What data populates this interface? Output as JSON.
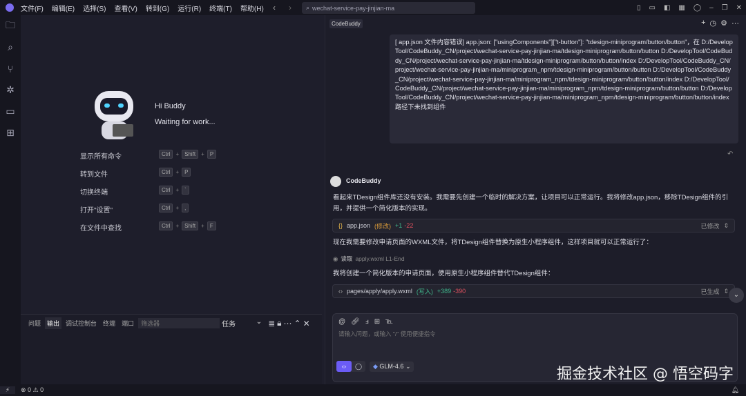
{
  "menu": [
    "文件(F)",
    "编辑(E)",
    "选择(S)",
    "查看(V)",
    "转到(G)",
    "运行(R)",
    "终端(T)",
    "帮助(H)"
  ],
  "search": "wechat-service-pay-jinjian-ma",
  "welcome": {
    "greeting": "Hi Buddy",
    "status": "Waiting for work..."
  },
  "commands": [
    {
      "label": "显示所有命令",
      "keys": [
        "Ctrl",
        "Shift",
        "P"
      ]
    },
    {
      "label": "转到文件",
      "keys": [
        "Ctrl",
        "P"
      ]
    },
    {
      "label": "切换终端",
      "keys": [
        "Ctrl",
        "`"
      ]
    },
    {
      "label": "打开\"设置\"",
      "keys": [
        "Ctrl",
        ","
      ]
    },
    {
      "label": "在文件中查找",
      "keys": [
        "Ctrl",
        "Shift",
        "F"
      ]
    }
  ],
  "panel": {
    "tabs": [
      "问题",
      "输出",
      "调试控制台",
      "终端",
      "端口"
    ],
    "filter_placeholder": "筛选器",
    "task_select": "任务"
  },
  "chat": {
    "tab": "CodeBuddy",
    "user_message": "[ app.json 文件内容错误] app.json: [\"usingComponents\"][\"t-button\"]: \"tdesign-miniprogram/button/button\"，在 D:/DevelopTool/CodeBuddy_CN/project/wechat-service-pay-jinjian-ma/tdesign-miniprogram/button/button D:/DevelopTool/CodeBuddy_CN/project/wechat-service-pay-jinjian-ma/tdesign-miniprogram/button/button/index D:/DevelopTool/CodeBuddy_CN/project/wechat-service-pay-jinjian-ma/miniprogram_npm/tdesign-miniprogram/button/button D:/DevelopTool/CodeBuddy_CN/project/wechat-service-pay-jinjian-ma/miniprogram_npm/tdesign-miniprogram/button/button/index D:/DevelopTool/CodeBuddy_CN/project/wechat-service-pay-jinjian-ma/miniprogram_npm/tdesign-miniprogram/button/button D:/DevelopTool/CodeBuddy_CN/project/wechat-service-pay-jinjian-ma/miniprogram_npm/tdesign-miniprogram/button/button/index 路径下未找到组件",
    "assistant_name": "CodeBuddy",
    "p1": "看起来TDesign组件库还没有安装。我需要先创建一个临时的解决方案，让项目可以正常运行。我将修改app.json，移除TDesign组件的引用，并提供一个简化版本的实现。",
    "file1": {
      "name": "app.json",
      "tag": "(修改)",
      "add": "+1",
      "del": "-22",
      "state": "已修改"
    },
    "p2": "现在我需要修改申请页面的WXML文件，将TDesign组件替换为原生小程序组件，这样项目就可以正常运行了：",
    "read": {
      "label": "读取",
      "file": "apply.wxml L1-End"
    },
    "p3": "我将创建一个简化版本的申请页面，使用原生小程序组件替代TDesign组件：",
    "file2": {
      "name": "pages/apply/apply.wxml",
      "tag": "(写入)",
      "add": "+389",
      "del": "-390",
      "state": "已生成"
    },
    "input_placeholder": "请输入问题，或输入 \"/\" 使用便捷指令",
    "model": "GLM-4.6"
  },
  "status": {
    "errors": "0",
    "warnings": "0"
  },
  "watermark": "掘金技术社区 @ 悟空码字",
  "colors": {
    "accent": "#6b5cf6",
    "add": "#3fb68b",
    "del": "#e0525f",
    "tag": "#d99a3a"
  }
}
